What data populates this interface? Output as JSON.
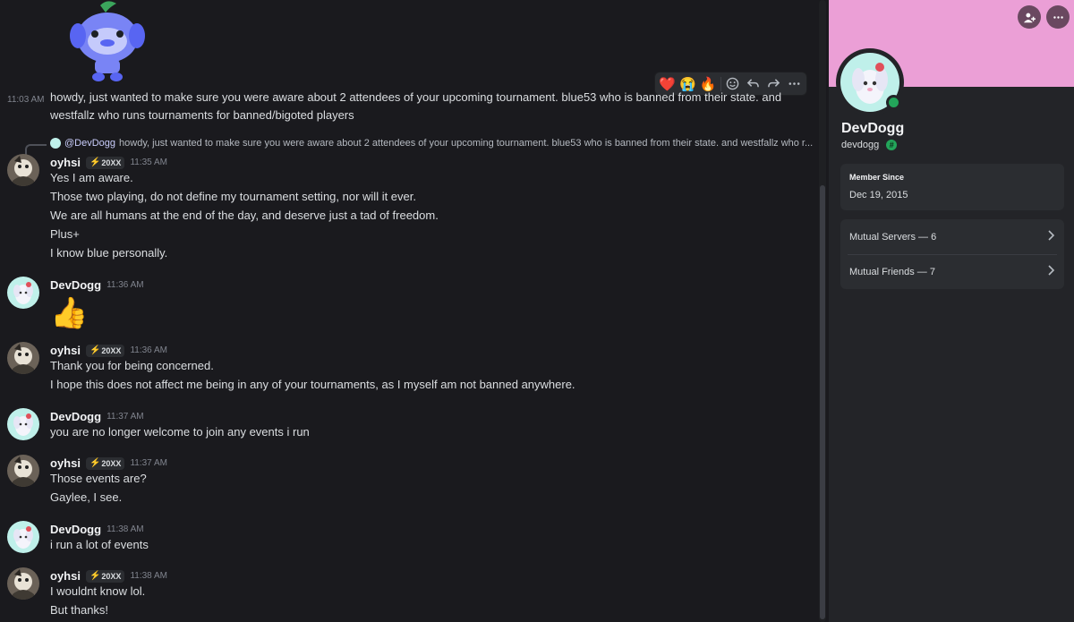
{
  "toolbar": {
    "reactions": [
      "❤️",
      "😭",
      "🔥"
    ],
    "icons": [
      "add-reaction-icon",
      "reply-icon",
      "forward-icon",
      "more-icon"
    ]
  },
  "messages": {
    "first": {
      "time": "11:03 AM",
      "text": "howdy, just wanted to make sure you were aware about 2 attendees of your upcoming tournament. blue53 who is banned from their state. and westfallz who runs tournaments for banned/bigoted players"
    },
    "reply": {
      "mention": "@DevDogg",
      "preview": "howdy, just wanted to make sure you were aware about 2 attendees of your upcoming tournament. blue53 who is banned from their state. and westfallz who r..."
    },
    "groups": [
      {
        "user": "oyhsi",
        "badge": "20XX",
        "time": "11:35 AM",
        "lines": [
          "Yes I am aware.",
          "Those two playing, do not define my tournament setting, nor will it ever.",
          "We are all humans at the end of the day, and deserve just a tad of freedom.",
          "Plus+",
          "I know blue personally."
        ]
      },
      {
        "user": "DevDogg",
        "time": "11:36 AM",
        "emoji": "👍"
      },
      {
        "user": "oyhsi",
        "badge": "20XX",
        "time": "11:36 AM",
        "lines": [
          "Thank you for being concerned.",
          "I hope this does not affect me being in any of your tournaments, as I myself am not banned anywhere."
        ]
      },
      {
        "user": "DevDogg",
        "time": "11:37 AM",
        "lines": [
          "you are no longer welcome to join any events i run"
        ]
      },
      {
        "user": "oyhsi",
        "badge": "20XX",
        "time": "11:37 AM",
        "lines": [
          "Those events are?",
          "Gaylee, I see."
        ]
      },
      {
        "user": "DevDogg",
        "time": "11:38 AM",
        "lines": [
          "i run a lot of events"
        ]
      },
      {
        "user": "oyhsi",
        "badge": "20XX",
        "time": "11:38 AM",
        "lines": [
          "I wouldnt know lol.",
          "But thanks!"
        ]
      }
    ]
  },
  "profile": {
    "display_name": "DevDogg",
    "username": "devdogg",
    "member_since_label": "Member Since",
    "member_since": "Dec 19, 2015",
    "mutual_servers": "Mutual Servers — 6",
    "mutual_friends": "Mutual Friends — 7",
    "banner_color": "#eb9fd6",
    "status_color": "#23a55a"
  }
}
